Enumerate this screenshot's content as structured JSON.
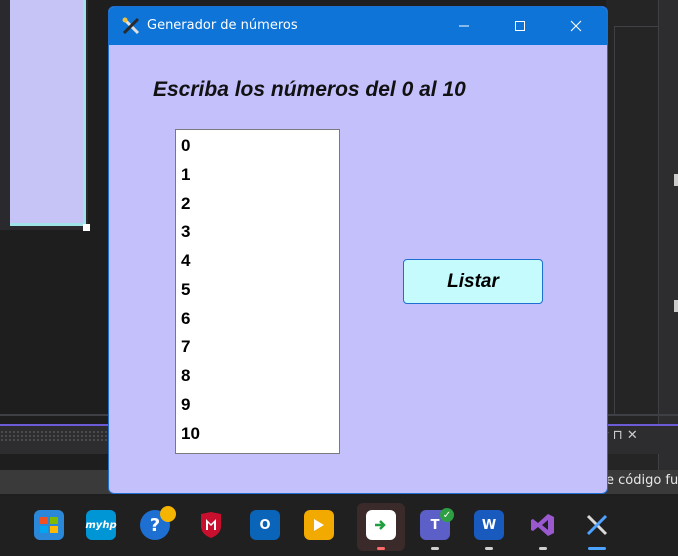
{
  "window": {
    "title": "Generador de números",
    "heading": "Escriba los números del 0 al 10",
    "list_items": [
      "0",
      "1",
      "2",
      "3",
      "4",
      "5",
      "6",
      "7",
      "8",
      "9",
      "10"
    ],
    "button_label": "Listar",
    "colors": {
      "client_bg": "#c3c0fc",
      "titlebar": "#0e74d8",
      "button_bg": "#c5fbfc"
    }
  },
  "background": {
    "status_text": "e código fu",
    "pin_glyphs": "▾ ⊓ ✕"
  },
  "taskbar": {
    "items": [
      {
        "name": "microsoft-store-icon"
      },
      {
        "name": "myhp-icon",
        "label": "myhp"
      },
      {
        "name": "help-icon"
      },
      {
        "name": "mcafee-icon"
      },
      {
        "name": "outlook-icon",
        "label": "O"
      },
      {
        "name": "power-automate-icon"
      },
      {
        "name": "file-transfer-icon"
      },
      {
        "name": "teams-icon",
        "label": "T"
      },
      {
        "name": "word-icon",
        "label": "W"
      },
      {
        "name": "visual-studio-icon"
      },
      {
        "name": "tools-app-icon"
      }
    ]
  }
}
